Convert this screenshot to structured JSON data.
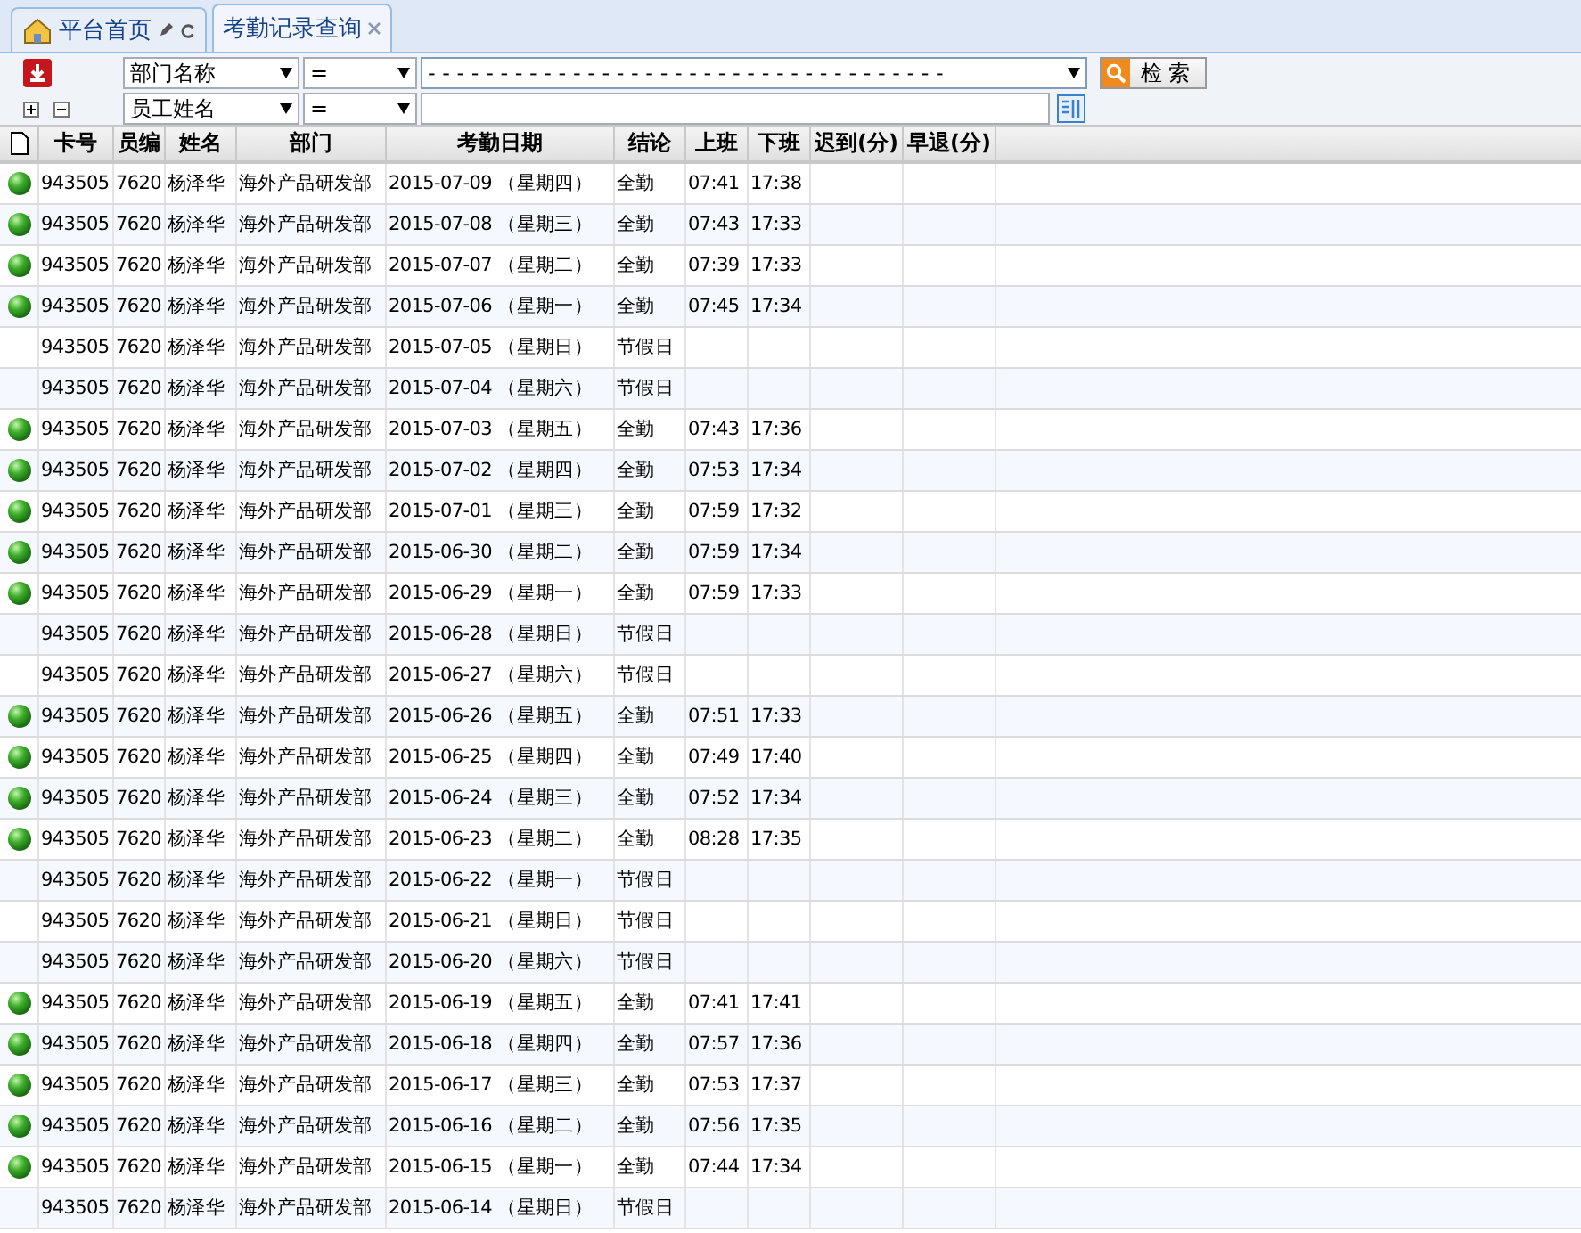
{
  "tabs": [
    {
      "label": "平台首页",
      "kind": "home",
      "selected": false
    },
    {
      "label": "考勤记录查询",
      "kind": "closable",
      "selected": true
    }
  ],
  "filters": [
    {
      "field": "部门名称",
      "operator": "=",
      "value": "- - - - - - - - - - - - - - - - - - - - - - - - - - - - - - - - - - - -",
      "kind": "dropdown"
    },
    {
      "field": "员工姓名",
      "operator": "=",
      "kind": "text"
    }
  ],
  "search_button": "检 索",
  "table": {
    "columns": [
      "卡号",
      "员编",
      "姓名",
      "部门",
      "考勤日期",
      "结论",
      "上班",
      "下班",
      "迟到(分)",
      "早退(分)"
    ],
    "rows": [
      {
        "ok": true,
        "card": "943505",
        "emp": "7620",
        "name": "杨泽华",
        "dept": "海外产品研发部",
        "date": "2015-07-09 （星期四）",
        "result": "全勤",
        "in": "07:41",
        "out": "17:38"
      },
      {
        "ok": true,
        "card": "943505",
        "emp": "7620",
        "name": "杨泽华",
        "dept": "海外产品研发部",
        "date": "2015-07-08 （星期三）",
        "result": "全勤",
        "in": "07:43",
        "out": "17:33"
      },
      {
        "ok": true,
        "card": "943505",
        "emp": "7620",
        "name": "杨泽华",
        "dept": "海外产品研发部",
        "date": "2015-07-07 （星期二）",
        "result": "全勤",
        "in": "07:39",
        "out": "17:33"
      },
      {
        "ok": true,
        "card": "943505",
        "emp": "7620",
        "name": "杨泽华",
        "dept": "海外产品研发部",
        "date": "2015-07-06 （星期一）",
        "result": "全勤",
        "in": "07:45",
        "out": "17:34"
      },
      {
        "ok": false,
        "card": "943505",
        "emp": "7620",
        "name": "杨泽华",
        "dept": "海外产品研发部",
        "date": "2015-07-05 （星期日）",
        "result": "节假日"
      },
      {
        "ok": false,
        "card": "943505",
        "emp": "7620",
        "name": "杨泽华",
        "dept": "海外产品研发部",
        "date": "2015-07-04 （星期六）",
        "result": "节假日"
      },
      {
        "ok": true,
        "card": "943505",
        "emp": "7620",
        "name": "杨泽华",
        "dept": "海外产品研发部",
        "date": "2015-07-03 （星期五）",
        "result": "全勤",
        "in": "07:43",
        "out": "17:36"
      },
      {
        "ok": true,
        "card": "943505",
        "emp": "7620",
        "name": "杨泽华",
        "dept": "海外产品研发部",
        "date": "2015-07-02 （星期四）",
        "result": "全勤",
        "in": "07:53",
        "out": "17:34"
      },
      {
        "ok": true,
        "card": "943505",
        "emp": "7620",
        "name": "杨泽华",
        "dept": "海外产品研发部",
        "date": "2015-07-01 （星期三）",
        "result": "全勤",
        "in": "07:59",
        "out": "17:32"
      },
      {
        "ok": true,
        "card": "943505",
        "emp": "7620",
        "name": "杨泽华",
        "dept": "海外产品研发部",
        "date": "2015-06-30 （星期二）",
        "result": "全勤",
        "in": "07:59",
        "out": "17:34"
      },
      {
        "ok": true,
        "card": "943505",
        "emp": "7620",
        "name": "杨泽华",
        "dept": "海外产品研发部",
        "date": "2015-06-29 （星期一）",
        "result": "全勤",
        "in": "07:59",
        "out": "17:33"
      },
      {
        "ok": false,
        "card": "943505",
        "emp": "7620",
        "name": "杨泽华",
        "dept": "海外产品研发部",
        "date": "2015-06-28 （星期日）",
        "result": "节假日"
      },
      {
        "ok": false,
        "card": "943505",
        "emp": "7620",
        "name": "杨泽华",
        "dept": "海外产品研发部",
        "date": "2015-06-27 （星期六）",
        "result": "节假日"
      },
      {
        "ok": true,
        "card": "943505",
        "emp": "7620",
        "name": "杨泽华",
        "dept": "海外产品研发部",
        "date": "2015-06-26 （星期五）",
        "result": "全勤",
        "in": "07:51",
        "out": "17:33"
      },
      {
        "ok": true,
        "card": "943505",
        "emp": "7620",
        "name": "杨泽华",
        "dept": "海外产品研发部",
        "date": "2015-06-25 （星期四）",
        "result": "全勤",
        "in": "07:49",
        "out": "17:40"
      },
      {
        "ok": true,
        "card": "943505",
        "emp": "7620",
        "name": "杨泽华",
        "dept": "海外产品研发部",
        "date": "2015-06-24 （星期三）",
        "result": "全勤",
        "in": "07:52",
        "out": "17:34"
      },
      {
        "ok": true,
        "card": "943505",
        "emp": "7620",
        "name": "杨泽华",
        "dept": "海外产品研发部",
        "date": "2015-06-23 （星期二）",
        "result": "全勤",
        "in": "08:28",
        "out": "17:35"
      },
      {
        "ok": false,
        "card": "943505",
        "emp": "7620",
        "name": "杨泽华",
        "dept": "海外产品研发部",
        "date": "2015-06-22 （星期一）",
        "result": "节假日"
      },
      {
        "ok": false,
        "card": "943505",
        "emp": "7620",
        "name": "杨泽华",
        "dept": "海外产品研发部",
        "date": "2015-06-21 （星期日）",
        "result": "节假日"
      },
      {
        "ok": false,
        "card": "943505",
        "emp": "7620",
        "name": "杨泽华",
        "dept": "海外产品研发部",
        "date": "2015-06-20 （星期六）",
        "result": "节假日"
      },
      {
        "ok": true,
        "card": "943505",
        "emp": "7620",
        "name": "杨泽华",
        "dept": "海外产品研发部",
        "date": "2015-06-19 （星期五）",
        "result": "全勤",
        "in": "07:41",
        "out": "17:41"
      },
      {
        "ok": true,
        "card": "943505",
        "emp": "7620",
        "name": "杨泽华",
        "dept": "海外产品研发部",
        "date": "2015-06-18 （星期四）",
        "result": "全勤",
        "in": "07:57",
        "out": "17:36"
      },
      {
        "ok": true,
        "card": "943505",
        "emp": "7620",
        "name": "杨泽华",
        "dept": "海外产品研发部",
        "date": "2015-06-17 （星期三）",
        "result": "全勤",
        "in": "07:53",
        "out": "17:37"
      },
      {
        "ok": true,
        "card": "943505",
        "emp": "7620",
        "name": "杨泽华",
        "dept": "海外产品研发部",
        "date": "2015-06-16 （星期二）",
        "result": "全勤",
        "in": "07:56",
        "out": "17:35"
      },
      {
        "ok": true,
        "card": "943505",
        "emp": "7620",
        "name": "杨泽华",
        "dept": "海外产品研发部",
        "date": "2015-06-15 （星期一）",
        "result": "全勤",
        "in": "07:44",
        "out": "17:34"
      },
      {
        "ok": false,
        "card": "943505",
        "emp": "7620",
        "name": "杨泽华",
        "dept": "海外产品研发部",
        "date": "2015-06-14 （星期日）",
        "result": "节假日"
      }
    ]
  }
}
